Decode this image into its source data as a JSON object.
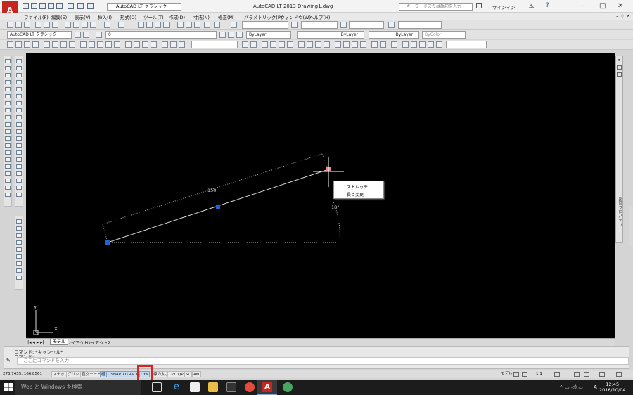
{
  "titlebar": {
    "workspace": "AutoCAD LT クラシック",
    "title": "AutoCAD LT 2013   Drawing1.dwg",
    "search_placeholder": "キーワードまたは語句を入力",
    "signin": "サインイン"
  },
  "menubar": {
    "items": [
      "ファイル(F)",
      "編集(E)",
      "表示(V)",
      "挿入(I)",
      "形式(O)",
      "ツール(T)",
      "作成(D)",
      "寸法(N)",
      "修正(M)",
      "パラメトリック(P)",
      "ウィンドウ(W)",
      "ヘルプ(H)"
    ]
  },
  "toolbars": {
    "workspace_combo": "AutoCAD LT クラシック",
    "layer_combo": "0",
    "color_combo": "ByLayer",
    "linetype_combo": "ByLayer",
    "lineweight_combo": "ByLayer",
    "plotstyle_combo": "ByColor"
  },
  "drawing": {
    "dimension_label": "150",
    "angle_label": "18°",
    "axis_y": "Y",
    "axis_x": "X"
  },
  "context_menu": {
    "items": [
      "ストレッチ",
      "長さ変更"
    ]
  },
  "layout_tabs": {
    "model": "モデル",
    "layout1": "レイアウト1",
    "layout2": "レイアウト2"
  },
  "command": {
    "history": [
      "コマンド: *キャンセル*",
      "コマンド:"
    ],
    "placeholder": "ここにコマンドを入力"
  },
  "statusbar": {
    "coords": "273.7455, 166.8561",
    "toggles": [
      {
        "label": "スナップ",
        "on": false
      },
      {
        "label": "グリッド",
        "on": false
      },
      {
        "label": "直交モード",
        "on": false
      },
      {
        "label": "極",
        "on": true
      },
      {
        "label": "OSNAP",
        "on": true
      },
      {
        "label": "OTRACK",
        "on": true
      },
      {
        "label": "DYN",
        "on": true
      },
      {
        "label": "線の太さ",
        "on": false
      },
      {
        "label": "TPY",
        "on": false
      },
      {
        "label": "QP",
        "on": false
      },
      {
        "label": "SC",
        "on": false
      },
      {
        "label": "AM",
        "on": false
      }
    ],
    "model_label": "モデル",
    "scale": "1:1"
  },
  "right_panel": {
    "label": "図面プロパティ"
  },
  "taskbar": {
    "search": "Web と Windows を検索",
    "ime": "A",
    "time": "12:45",
    "date": "2016/10/04"
  }
}
